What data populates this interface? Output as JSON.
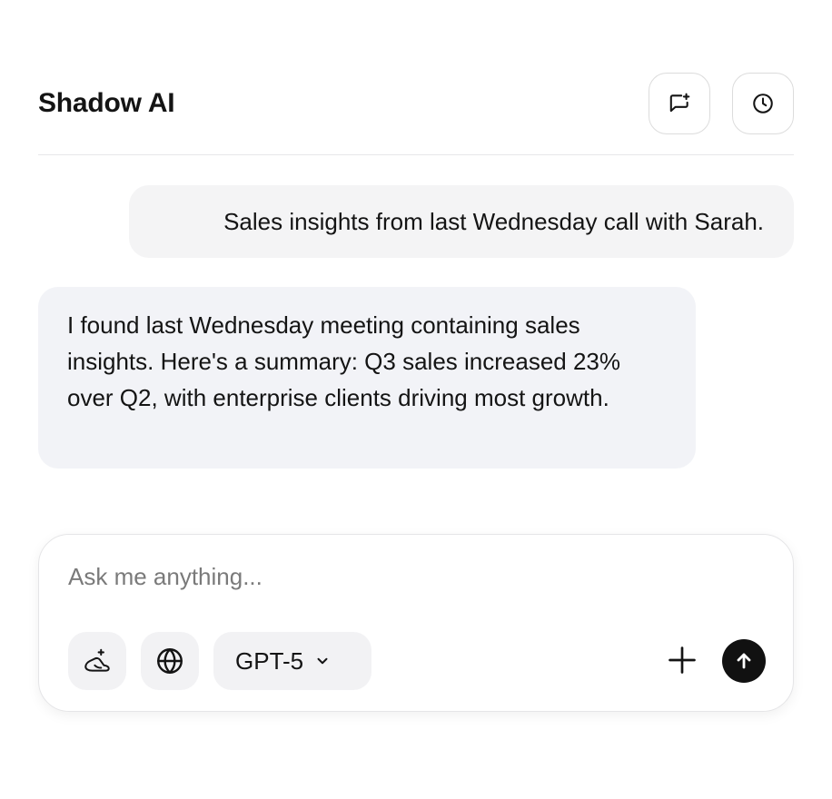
{
  "app": {
    "title": "Shadow AI"
  },
  "header": {
    "new_chat_icon": "new-chat-icon",
    "history_icon": "history-clock-icon"
  },
  "conversation": {
    "messages": [
      {
        "role": "user",
        "text": "Sales insights from last Wednesday call with Sarah."
      },
      {
        "role": "assistant",
        "text": "I found last Wednesday meeting containing sales insights. Here's a summary: Q3 sales increased 23% over Q2, with enterprise clients driving most growth."
      }
    ]
  },
  "composer": {
    "placeholder": "Ask me anything...",
    "value": "",
    "model": "GPT-5",
    "tools_icon": "magic-hat-icon",
    "web_icon": "globe-icon",
    "attach_icon": "plus-icon",
    "send_icon": "arrow-up-icon"
  },
  "colors": {
    "user_bubble": "#f4f4f5",
    "assistant_bubble": "#f2f3f7",
    "send_button": "#111111",
    "tool_button": "#f2f2f4",
    "border": "#dcdcdc"
  }
}
